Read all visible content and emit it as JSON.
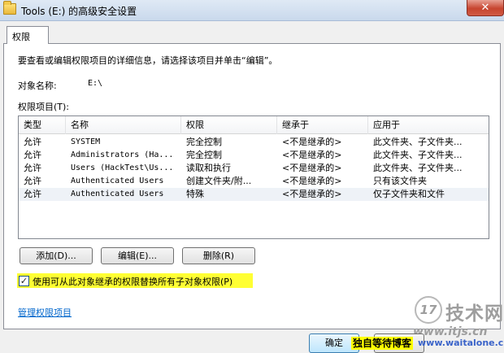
{
  "window": {
    "title": "Tools (E:) 的高级安全设置",
    "close_glyph": "✕"
  },
  "tab": {
    "label": "权限"
  },
  "intro_text": "要查看或编辑权限项目的详细信息，请选择该项目并单击“编辑”。",
  "object_name": {
    "label": "对象名称:",
    "value": "E:\\"
  },
  "permission_entries_label": "权限项目(T):",
  "table": {
    "columns": [
      "类型",
      "名称",
      "权限",
      "继承于",
      "应用于"
    ],
    "rows": [
      {
        "type": "允许",
        "name": "SYSTEM",
        "permission": "完全控制",
        "inherited": "<不是继承的>",
        "applies": "此文件夹、子文件夹..."
      },
      {
        "type": "允许",
        "name": "Administrators (Ha...",
        "permission": "完全控制",
        "inherited": "<不是继承的>",
        "applies": "此文件夹、子文件夹..."
      },
      {
        "type": "允许",
        "name": "Users (HackTest\\Us...",
        "permission": "读取和执行",
        "inherited": "<不是继承的>",
        "applies": "此文件夹、子文件夹..."
      },
      {
        "type": "允许",
        "name": "Authenticated Users",
        "permission": "创建文件夹/附...",
        "inherited": "<不是继承的>",
        "applies": "只有该文件夹"
      },
      {
        "type": "允许",
        "name": "Authenticated Users",
        "permission": "特殊",
        "inherited": "<不是继承的>",
        "applies": "仅子文件夹和文件"
      }
    ]
  },
  "buttons": {
    "add": "添加(D)...",
    "edit": "编辑(E)...",
    "remove": "删除(R)"
  },
  "replace_checkbox": {
    "label": "使用可从此对象继承的权限替换所有子对象权限(P)",
    "checked": true,
    "mark": "✓"
  },
  "manage_link": "管理权限项目",
  "footer": {
    "ok": "确定"
  },
  "watermark": {
    "circle": "17",
    "big": "技术网",
    "url": "www.itjs.cn",
    "tag": "独自等待博客",
    "tag2": "www.waitalone.cn"
  }
}
